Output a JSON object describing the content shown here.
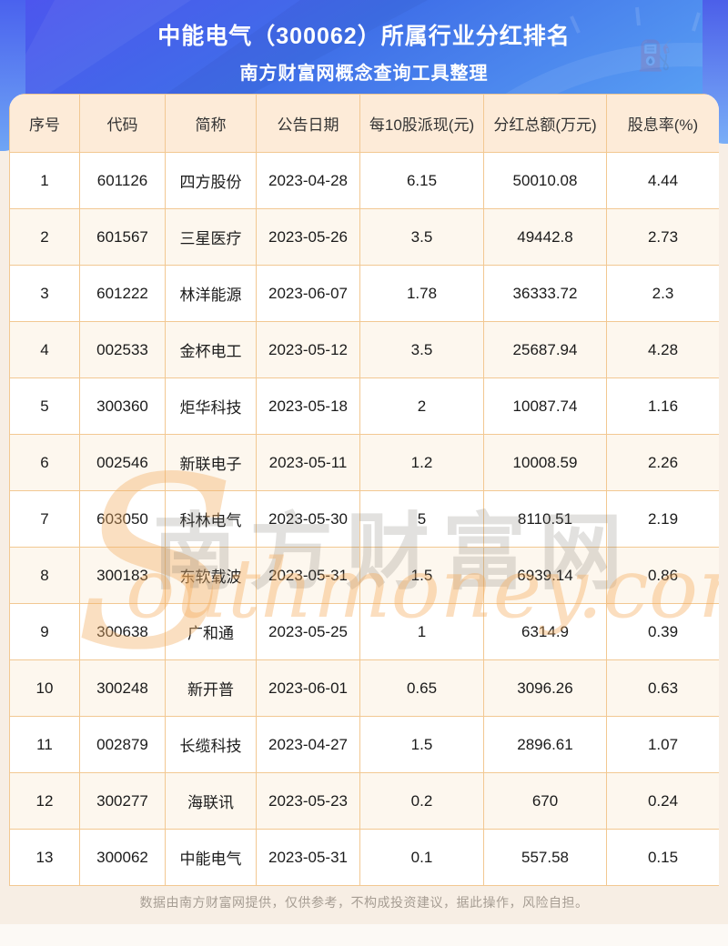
{
  "header": {
    "title_line1": "中能电气（300062）所属行业分红排名",
    "title_line2": "南方财富网概念查询工具整理"
  },
  "chart_data": {
    "type": "table",
    "title": "中能电气（300062）所属行业分红排名",
    "subtitle": "南方财富网概念查询工具整理",
    "columns": [
      "序号",
      "代码",
      "简称",
      "公告日期",
      "每10股派现(元)",
      "分红总额(万元)",
      "股息率(%)"
    ],
    "rows": [
      [
        "1",
        "601126",
        "四方股份",
        "2023-04-28",
        "6.15",
        "50010.08",
        "4.44"
      ],
      [
        "2",
        "601567",
        "三星医疗",
        "2023-05-26",
        "3.5",
        "49442.8",
        "2.73"
      ],
      [
        "3",
        "601222",
        "林洋能源",
        "2023-06-07",
        "1.78",
        "36333.72",
        "2.3"
      ],
      [
        "4",
        "002533",
        "金杯电工",
        "2023-05-12",
        "3.5",
        "25687.94",
        "4.28"
      ],
      [
        "5",
        "300360",
        "炬华科技",
        "2023-05-18",
        "2",
        "10087.74",
        "1.16"
      ],
      [
        "6",
        "002546",
        "新联电子",
        "2023-05-11",
        "1.2",
        "10008.59",
        "2.26"
      ],
      [
        "7",
        "603050",
        "科林电气",
        "2023-05-30",
        "5",
        "8110.51",
        "2.19"
      ],
      [
        "8",
        "300183",
        "东软载波",
        "2023-05-31",
        "1.5",
        "6939.14",
        "0.86"
      ],
      [
        "9",
        "300638",
        "广和通",
        "2023-05-25",
        "1",
        "6314.9",
        "0.39"
      ],
      [
        "10",
        "300248",
        "新开普",
        "2023-06-01",
        "0.65",
        "3096.26",
        "0.63"
      ],
      [
        "11",
        "002879",
        "长缆科技",
        "2023-04-27",
        "1.5",
        "2896.61",
        "1.07"
      ],
      [
        "12",
        "300277",
        "海联讯",
        "2023-05-23",
        "0.2",
        "670",
        "0.24"
      ],
      [
        "13",
        "300062",
        "中能电气",
        "2023-05-31",
        "0.1",
        "557.58",
        "0.15"
      ]
    ]
  },
  "watermark": {
    "s": "S",
    "cn": "南方财富网",
    "en": "outhmoney.com"
  },
  "footer": {
    "disclaimer": "数据由南方财富网提供，仅供参考，不构成投资建议，据此操作，风险自担。"
  },
  "colors": {
    "banner_blue_top": "#4d54ee",
    "banner_blue_bottom": "#5aa2f4",
    "table_header_bg": "#fdebd8",
    "table_border": "#f2c892",
    "row_alt_bg": "#fdf7ee",
    "page_bg": "#f7eee5",
    "watermark_orange": "#f4a858"
  }
}
